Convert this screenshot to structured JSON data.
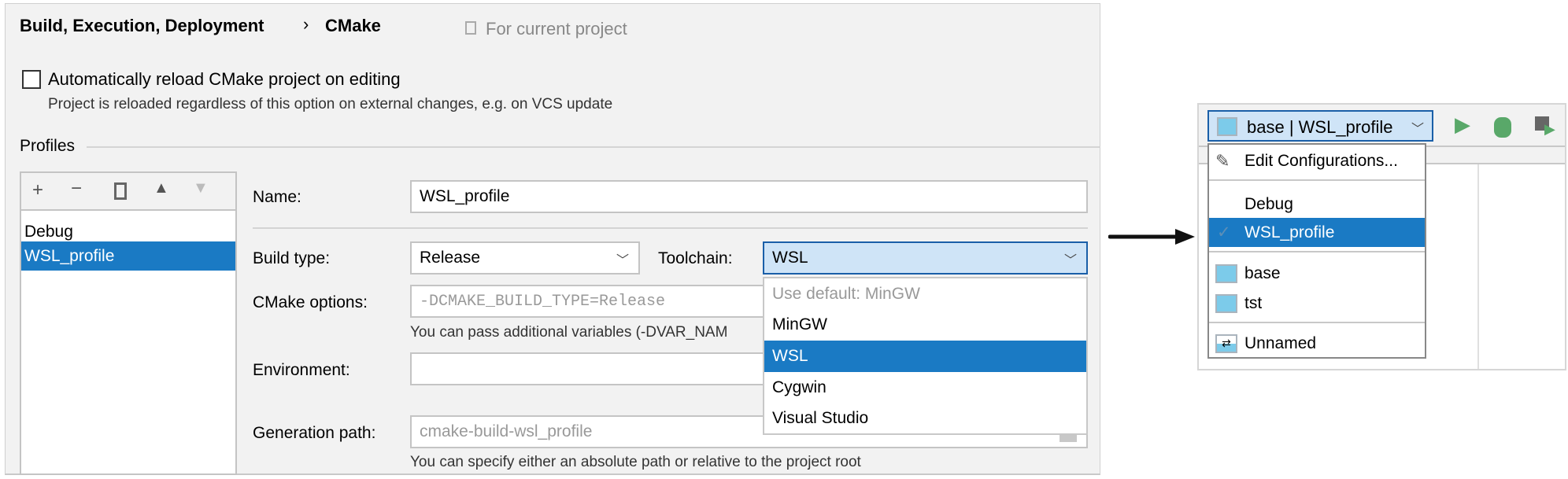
{
  "header": {
    "breadcrumb_parent": "Build, Execution, Deployment",
    "separator": "›",
    "breadcrumb_current": "CMake",
    "scope": "For current project"
  },
  "auto_reload": {
    "label": "Automatically reload CMake project on editing",
    "checked": false,
    "note": "Project is reloaded regardless of this option on external changes, e.g. on VCS update"
  },
  "profiles": {
    "section_label": "Profiles",
    "toolbar": [
      "add-icon",
      "remove-icon",
      "copy-icon",
      "move-up-icon",
      "move-down-icon"
    ],
    "items": [
      "Debug",
      "WSL_profile"
    ],
    "selected": "WSL_profile"
  },
  "form": {
    "name_label": "Name:",
    "name_value": "WSL_profile",
    "build_type_label": "Build type:",
    "build_type_value": "Release",
    "toolchain_label": "Toolchain:",
    "toolchain_value": "WSL",
    "cmake_options_label": "CMake options:",
    "cmake_options_value": "-DCMAKE_BUILD_TYPE=Release",
    "cmake_options_hint": "You can pass additional variables (-DVAR_NAM",
    "environment_label": "Environment:",
    "environment_value": "",
    "generation_path_label": "Generation path:",
    "generation_path_value": "cmake-build-wsl_profile",
    "generation_path_hint": "You can specify either an absolute path or relative to the project root"
  },
  "toolchain_dropdown": {
    "items": [
      "Use default: MinGW",
      "MinGW",
      "WSL",
      "Cygwin",
      "Visual Studio"
    ],
    "selected": "WSL"
  },
  "run_config": {
    "combo_label": "base | WSL_profile",
    "edit": "Edit Configurations...",
    "profiles": [
      "Debug",
      "WSL_profile"
    ],
    "selected": "WSL_profile",
    "targets": [
      "base",
      "tst"
    ],
    "other": "Unnamed",
    "colors": {
      "accent": "#1a7ac4",
      "run": "#59a869"
    }
  }
}
